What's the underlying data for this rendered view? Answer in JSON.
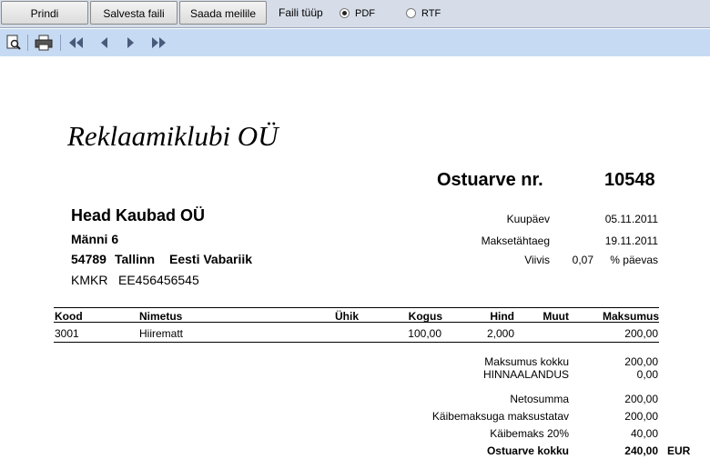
{
  "toolbar": {
    "print_label": "Prindi",
    "save_label": "Salvesta faili",
    "email_label": "Saada meilile",
    "filetype_label": "Faili tüüp",
    "pdf_label": "PDF",
    "rtf_label": "RTF",
    "selected_filetype": "PDF"
  },
  "viewer": {
    "icons": [
      "page-preview-icon",
      "printer-icon",
      "first-page-icon",
      "previous-page-icon",
      "next-page-icon",
      "last-page-icon"
    ]
  },
  "invoice": {
    "seller": "Reklaamiklubi OÜ",
    "title": "Ostuarve nr.",
    "number": "10548",
    "buyer": {
      "name": "Head Kaubad OÜ",
      "street": "Männi 6",
      "zip": "54789",
      "city": "Tallinn",
      "country": "Eesti Vabariik",
      "kmkr_label": "KMKR",
      "kmkr": "EE456456545"
    },
    "meta": {
      "date_label": "Kuupäev",
      "date": "05.11.2011",
      "due_label": "Maksetähtaeg",
      "due": "19.11.2011",
      "penalty_label": "Viivis",
      "penalty": "0,07",
      "penalty_unit": "% päevas"
    },
    "columns": {
      "code": "Kood",
      "name": "Nimetus",
      "unit": "Ühik",
      "qty": "Kogus",
      "price": "Hind",
      "other": "Muut",
      "amount": "Maksumus"
    },
    "rows": [
      {
        "code": "3001",
        "name": "Hiirematt",
        "unit": "",
        "qty": "100,00",
        "price": "2,000",
        "other": "",
        "amount": "200,00"
      }
    ],
    "totals": {
      "sum_label": "Maksumus kokku",
      "sum": "200,00",
      "discount_label": "HINNAALANDUS",
      "discount": "0,00",
      "net_label": "Netosumma",
      "net": "200,00",
      "taxable_label": "Käibemaksuga maksustatav",
      "taxable": "200,00",
      "vat_label": "Käibemaks 20%",
      "vat": "40,00",
      "total_label": "Ostuarve kokku",
      "total": "240,00",
      "currency": "EUR"
    }
  }
}
